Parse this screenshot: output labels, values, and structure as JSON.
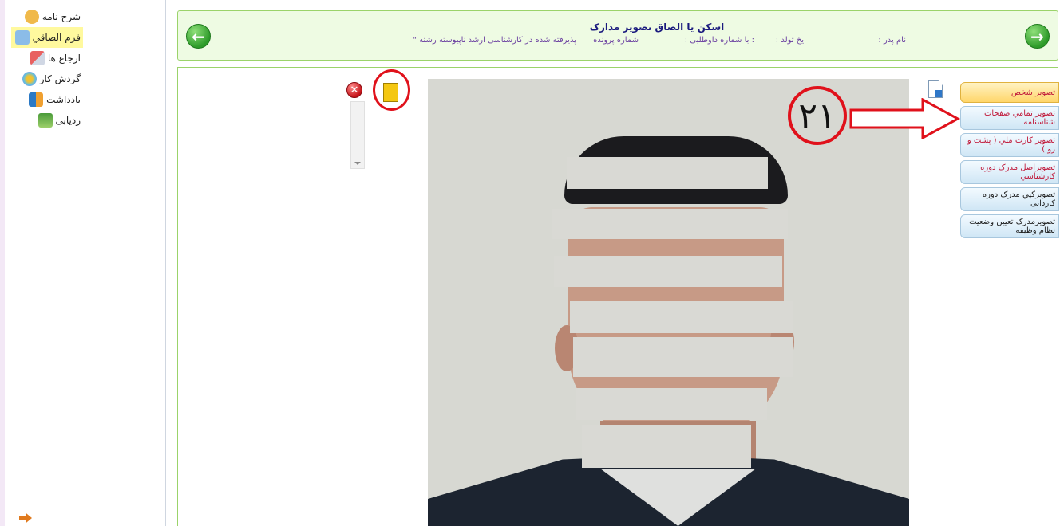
{
  "sidebar": {
    "items": [
      {
        "label": "شرح نامه",
        "icon": "envelope-icon",
        "active": false
      },
      {
        "label": "فرم الصاقي",
        "icon": "form-icon",
        "active": true
      },
      {
        "label": "ارجاع ها",
        "icon": "referral-icon",
        "active": false
      },
      {
        "label": "گردش کار",
        "icon": "workflow-icon",
        "active": false
      },
      {
        "label": "يادداشت",
        "icon": "note-icon",
        "active": false
      },
      {
        "label": "ردیابی",
        "icon": "tracking-icon",
        "active": false
      }
    ],
    "exit_icon": "exit-icon"
  },
  "header": {
    "title": "اسکن یا الصاق تصویر مدارک",
    "father_name_label": "نام پدر :",
    "birth_date_label": "يخ تولد :",
    "applicant_label": ": با شماره داوطلبی :",
    "file_number_label": "شماره پرونده",
    "admission_text": "پذیرفته شده در کارشناسی ارشد ناپیوسته رشته \""
  },
  "tabs": [
    {
      "label": "تصویر شخص",
      "selected": true
    },
    {
      "label": "تصوير تمامي صفحات شناسنامه",
      "selected": false
    },
    {
      "label": "تصویر کارت ملي ( پشت و رو )",
      "selected": false
    },
    {
      "label": "تصويراصل مدرک دوره کارشناسي",
      "selected": false
    },
    {
      "label": "تصویرکپي مدرک دوره کاردانی",
      "selected": false
    },
    {
      "label": "تصويرمدرک تعيين وضعيت نظام وظيفه",
      "selected": false
    }
  ],
  "annotation": {
    "number": "۲۱"
  },
  "colors": {
    "header_bg": "#eefbe3",
    "header_border": "#9bd36a",
    "tab_selected": "#ffd66a",
    "tab_text": "#c0193a",
    "annotation_red": "#e0111b"
  }
}
